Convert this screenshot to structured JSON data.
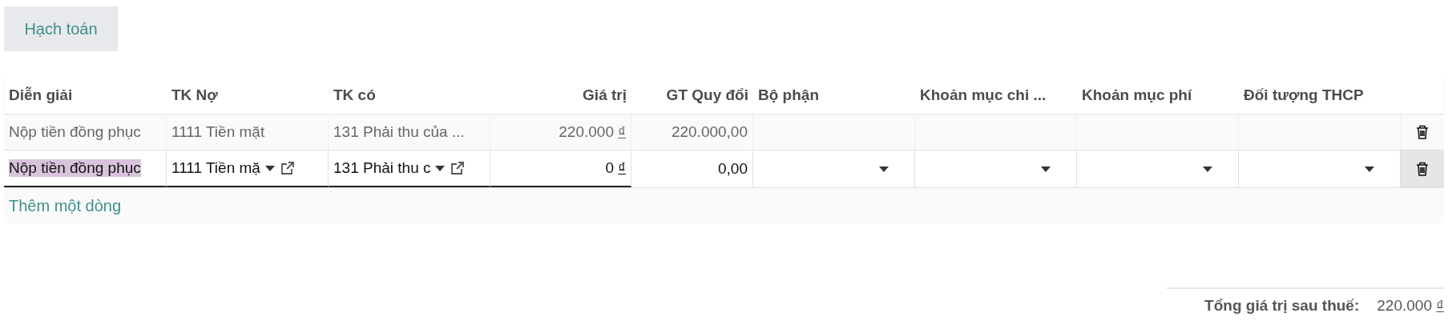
{
  "button": {
    "label": "Hạch toán"
  },
  "table": {
    "columns": [
      {
        "label": "Diễn giải"
      },
      {
        "label": "TK Nợ"
      },
      {
        "label": "TK có"
      },
      {
        "label": "Giá trị"
      },
      {
        "label": "GT Quy đổi"
      },
      {
        "label": "Bộ phận"
      },
      {
        "label": "Khoản mục chi ..."
      },
      {
        "label": "Khoản mục phí"
      },
      {
        "label": "Đối tượng THCP"
      }
    ],
    "rows": [
      {
        "kind": "readonly",
        "cells": [
          {
            "kind": "text",
            "value": "Nộp tiền đồng phục"
          },
          {
            "kind": "text",
            "value": "1111 Tiền mặt"
          },
          {
            "kind": "text",
            "value": "131 Phải thu của ..."
          },
          {
            "kind": "money",
            "value": "220.000",
            "currency": "₫"
          },
          {
            "kind": "number",
            "value": "220.000,00"
          },
          {
            "kind": "empty"
          },
          {
            "kind": "empty"
          },
          {
            "kind": "empty"
          },
          {
            "kind": "empty"
          }
        ]
      },
      {
        "kind": "edit",
        "cells": [
          {
            "kind": "input",
            "value": "Nộp tiền đồng phục",
            "highlighted": true
          },
          {
            "kind": "select",
            "value": "1111 Tiền mặ",
            "external_link": true
          },
          {
            "kind": "select",
            "value": "131 Phải thu c",
            "external_link": true
          },
          {
            "kind": "money",
            "value": "0",
            "currency": "₫"
          },
          {
            "kind": "number",
            "value": "0,00"
          },
          {
            "kind": "select",
            "external_link": false
          },
          {
            "kind": "select",
            "external_link": false
          },
          {
            "kind": "select",
            "external_link": false
          },
          {
            "kind": "select",
            "external_link": false
          }
        ]
      }
    ],
    "add_line": "Thêm một dòng"
  },
  "total": {
    "label": "Tổng giá trị sau thuế:",
    "amount": "220.000",
    "currency": "₫"
  }
}
